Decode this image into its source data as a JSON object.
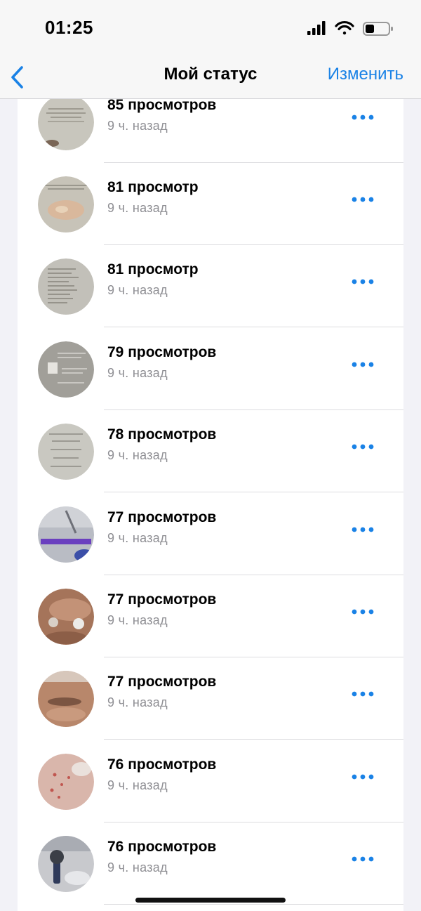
{
  "status_bar": {
    "time": "01:25"
  },
  "nav": {
    "back_icon": "chevron-left-icon",
    "title": "Мой статус",
    "edit": "Изменить"
  },
  "colors": {
    "accent": "#1a82e6",
    "secondary_text": "#8e8e93"
  },
  "statuses": [
    {
      "views": "85 просмотров",
      "time": "9 ч. назад",
      "thumb": "text-slide-thumbnail"
    },
    {
      "views": "81 просмотр",
      "time": "9 ч. назад",
      "thumb": "photo-with-text-thumbnail"
    },
    {
      "views": "81 просмотр",
      "time": "9 ч. назад",
      "thumb": "bullet-list-slide-thumbnail"
    },
    {
      "views": "79 просмотров",
      "time": "9 ч. назад",
      "thumb": "numbered-list-slide-thumbnail"
    },
    {
      "views": "78 просмотров",
      "time": "9 ч. назад",
      "thumb": "text-slide-thumbnail"
    },
    {
      "views": "77 просмотров",
      "time": "9 ч. назад",
      "thumb": "device-photo-thumbnail"
    },
    {
      "views": "77 просмотров",
      "time": "9 ч. назад",
      "thumb": "skin-procedure-thumbnail"
    },
    {
      "views": "77 просмотров",
      "time": "9 ч. назад",
      "thumb": "face-closeup-thumbnail"
    },
    {
      "views": "76 просмотров",
      "time": "9 ч. назад",
      "thumb": "skin-closeup-thumbnail"
    },
    {
      "views": "76 просмотров",
      "time": "9 ч. назад",
      "thumb": "roller-device-thumbnail"
    }
  ]
}
